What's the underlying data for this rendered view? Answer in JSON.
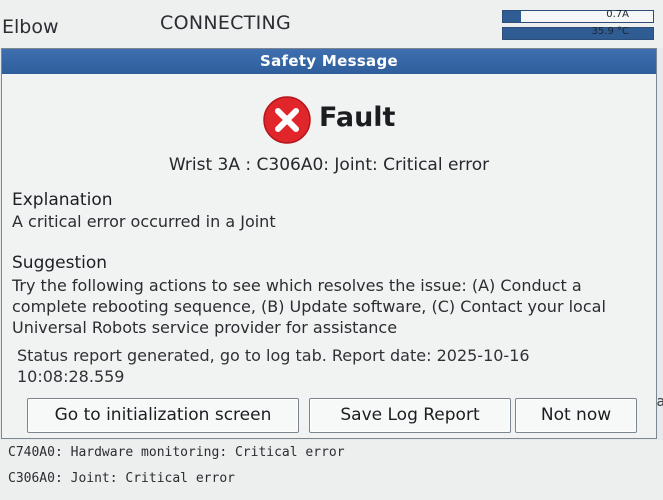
{
  "topbar": {
    "joint_label": "Elbow",
    "connection_status": "CONNECTING",
    "current_meter": {
      "value_text": "0.7A",
      "level": 0.12
    },
    "temp_meter": {
      "value_text": "35.9 °C",
      "level": 1.0
    }
  },
  "dialog": {
    "title": "Safety Message",
    "fault_title": "Fault",
    "error_line": "Wrist 3A : C306A0: Joint: Critical error",
    "explanation_heading": "Explanation",
    "explanation_text": "A critical error occurred in a Joint",
    "suggestion_heading": "Suggestion",
    "suggestion_text": "Try the following actions to see which resolves the issue: (A) Conduct a complete rebooting sequence, (B) Update software, (C) Contact your local Universal Robots service provider for assistance",
    "status_report": "Status report generated, go to log tab. Report date: 2025-10-16 10:08:28.559",
    "buttons": {
      "init": "Go to initialization screen",
      "save_log": "Save Log Report",
      "not_now": "Not now"
    }
  },
  "background_log": {
    "rows": [
      "C740A0: Hardware monitoring: Critical error",
      "C306A0: Joint: Critical error"
    ],
    "side_text": "wa"
  },
  "colors": {
    "header_blue": "#2e5e9c",
    "fault_red": "#e0262a"
  },
  "icons": {
    "fault": "x-circle-icon"
  }
}
